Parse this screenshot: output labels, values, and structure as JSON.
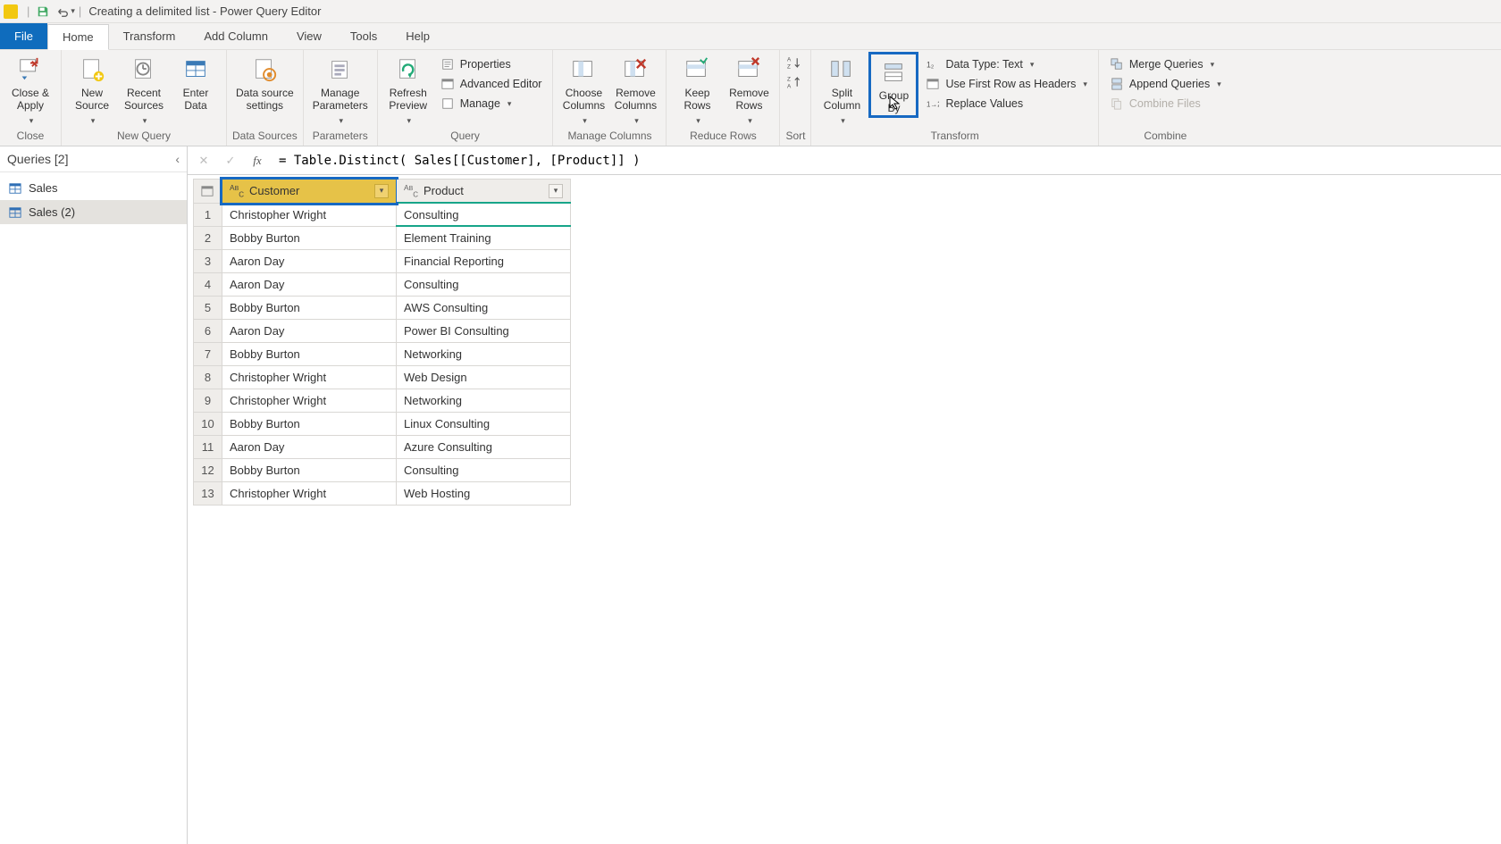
{
  "titlebar": {
    "title": "Creating a delimited list - Power Query Editor"
  },
  "ribbon_tabs": {
    "file": "File",
    "home": "Home",
    "transform": "Transform",
    "add_column": "Add Column",
    "view": "View",
    "tools": "Tools",
    "help": "Help"
  },
  "ribbon": {
    "close": {
      "close_apply": "Close &\nApply",
      "group": "Close"
    },
    "new_query": {
      "new_source": "New\nSource",
      "recent_sources": "Recent\nSources",
      "enter_data": "Enter\nData",
      "group": "New Query"
    },
    "data_sources": {
      "data_source_settings": "Data source\nsettings",
      "group": "Data Sources"
    },
    "parameters": {
      "manage_parameters": "Manage\nParameters",
      "group": "Parameters"
    },
    "query": {
      "refresh_preview": "Refresh\nPreview",
      "properties": "Properties",
      "advanced_editor": "Advanced Editor",
      "manage": "Manage",
      "group": "Query"
    },
    "manage_columns": {
      "choose_columns": "Choose\nColumns",
      "remove_columns": "Remove\nColumns",
      "group": "Manage Columns"
    },
    "reduce_rows": {
      "keep_rows": "Keep\nRows",
      "remove_rows": "Remove\nRows",
      "group": "Reduce Rows"
    },
    "sort": {
      "group": "Sort"
    },
    "transform": {
      "split_column": "Split\nColumn",
      "group_by": "Group\nBy",
      "data_type": "Data Type: Text",
      "headers": "Use First Row as Headers",
      "replace_values": "Replace Values",
      "group": "Transform"
    },
    "combine": {
      "merge_queries": "Merge Queries",
      "append_queries": "Append Queries",
      "combine_files": "Combine Files",
      "group": "Combine"
    }
  },
  "queries_pane": {
    "title": "Queries [2]",
    "items": [
      {
        "label": "Sales"
      },
      {
        "label": "Sales (2)"
      }
    ]
  },
  "formula": "= Table.Distinct( Sales[[Customer], [Product]] )",
  "grid": {
    "columns": [
      {
        "name": "Customer",
        "type_label": "ABC"
      },
      {
        "name": "Product",
        "type_label": "ABC"
      }
    ],
    "rows": [
      {
        "n": 1,
        "customer": "Christopher Wright",
        "product": "Consulting"
      },
      {
        "n": 2,
        "customer": "Bobby Burton",
        "product": "Element Training"
      },
      {
        "n": 3,
        "customer": "Aaron Day",
        "product": "Financial Reporting"
      },
      {
        "n": 4,
        "customer": "Aaron Day",
        "product": "Consulting"
      },
      {
        "n": 5,
        "customer": "Bobby Burton",
        "product": "AWS Consulting"
      },
      {
        "n": 6,
        "customer": "Aaron Day",
        "product": "Power BI Consulting"
      },
      {
        "n": 7,
        "customer": "Bobby Burton",
        "product": "Networking"
      },
      {
        "n": 8,
        "customer": "Christopher Wright",
        "product": "Web Design"
      },
      {
        "n": 9,
        "customer": "Christopher Wright",
        "product": "Networking"
      },
      {
        "n": 10,
        "customer": "Bobby Burton",
        "product": "Linux Consulting"
      },
      {
        "n": 11,
        "customer": "Aaron Day",
        "product": "Azure Consulting"
      },
      {
        "n": 12,
        "customer": "Bobby Burton",
        "product": "Consulting"
      },
      {
        "n": 13,
        "customer": "Christopher Wright",
        "product": "Web Hosting"
      }
    ]
  }
}
